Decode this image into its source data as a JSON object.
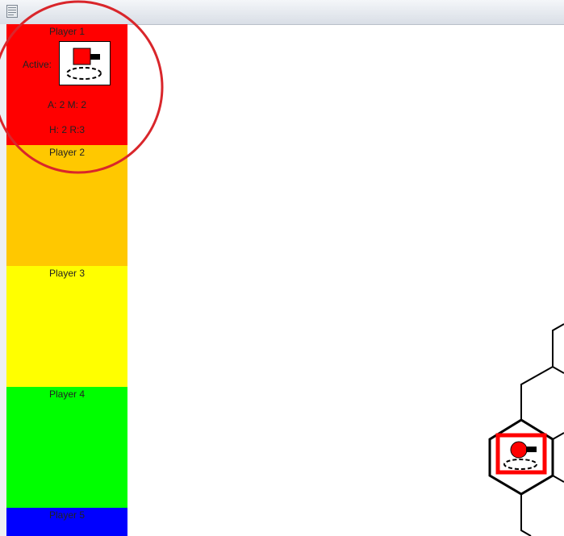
{
  "players": [
    {
      "name": "Player 1",
      "color": "#ff0000"
    },
    {
      "name": "Player 2",
      "color": "#ffc800"
    },
    {
      "name": "Player 3",
      "color": "#ffff00"
    },
    {
      "name": "Player 4",
      "color": "#00ff00"
    },
    {
      "name": "Player 5",
      "color": "#0000ff"
    }
  ],
  "active_player": {
    "active_label": "Active:",
    "stats_line1": "A: 2  M: 2",
    "stats_line2": "H: 2  R:3",
    "unit_icon": "tank-icon"
  },
  "annotation": {
    "shape": "circle-highlight",
    "color": "#d9262b"
  },
  "board": {
    "hex_stroke": "#000000",
    "unit_color": "#ff0000",
    "unit_icon": "tank-icon"
  }
}
